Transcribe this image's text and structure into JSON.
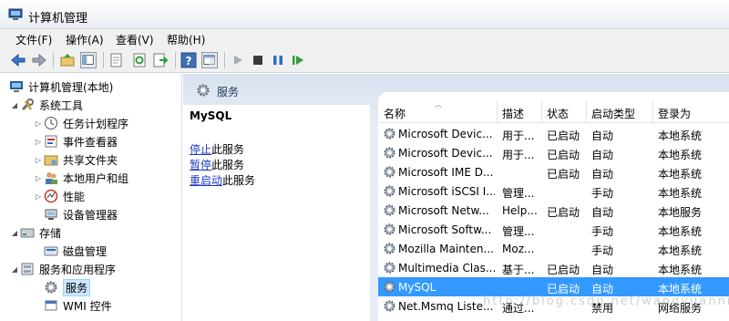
{
  "window": {
    "title": "计算机管理"
  },
  "menu": [
    "文件(F)",
    "操作(A)",
    "查看(V)",
    "帮助(H)"
  ],
  "tree": {
    "root": "计算机管理(本地)",
    "system_tools": "系统工具",
    "task_scheduler": "任务计划程序",
    "event_viewer": "事件查看器",
    "shared_folders": "共享文件夹",
    "local_users": "本地用户和组",
    "performance": "性能",
    "device_manager": "设备管理器",
    "storage": "存储",
    "disk_management": "磁盘管理",
    "services_apps": "服务和应用程序",
    "services": "服务",
    "wmi": "WMI 控件"
  },
  "panel": {
    "title": "服务"
  },
  "detail": {
    "service_name": "MySQL",
    "stop_link": "停止",
    "stop_suffix": "此服务",
    "pause_link": "暂停",
    "pause_suffix": "此服务",
    "restart_link": "重启动",
    "restart_suffix": "此服务"
  },
  "columns": {
    "name": "名称",
    "description": "描述",
    "status": "状态",
    "startup": "启动类型",
    "logon": "登录为"
  },
  "rows": [
    {
      "name": "Microsoft Devic...",
      "desc": "用于...",
      "status": "已启动",
      "startup": "自动",
      "logon": "本地系统"
    },
    {
      "name": "Microsoft Devic...",
      "desc": "用于...",
      "status": "已启动",
      "startup": "自动",
      "logon": "本地系统"
    },
    {
      "name": "Microsoft IME D...",
      "desc": "",
      "status": "已启动",
      "startup": "自动",
      "logon": "本地系统"
    },
    {
      "name": "Microsoft iSCSI I...",
      "desc": "管理...",
      "status": "",
      "startup": "手动",
      "logon": "本地系统"
    },
    {
      "name": "Microsoft Netw...",
      "desc": "Help...",
      "status": "已启动",
      "startup": "自动",
      "logon": "本地服务"
    },
    {
      "name": "Microsoft Softw...",
      "desc": "管理...",
      "status": "",
      "startup": "手动",
      "logon": "本地系统"
    },
    {
      "name": "Mozilla Mainten...",
      "desc": "Moz...",
      "status": "",
      "startup": "手动",
      "logon": "本地系统"
    },
    {
      "name": "Multimedia Clas...",
      "desc": "基于...",
      "status": "已启动",
      "startup": "自动",
      "logon": "本地系统"
    },
    {
      "name": "MySQL",
      "desc": "",
      "status": "已启动",
      "startup": "自动",
      "logon": "本地系统"
    },
    {
      "name": "Net.Msmq Liste...",
      "desc": "通过...",
      "status": "",
      "startup": "禁用",
      "logon": "网络服务"
    }
  ],
  "watermark": "http://blog.csdn.net/wangyuannian"
}
